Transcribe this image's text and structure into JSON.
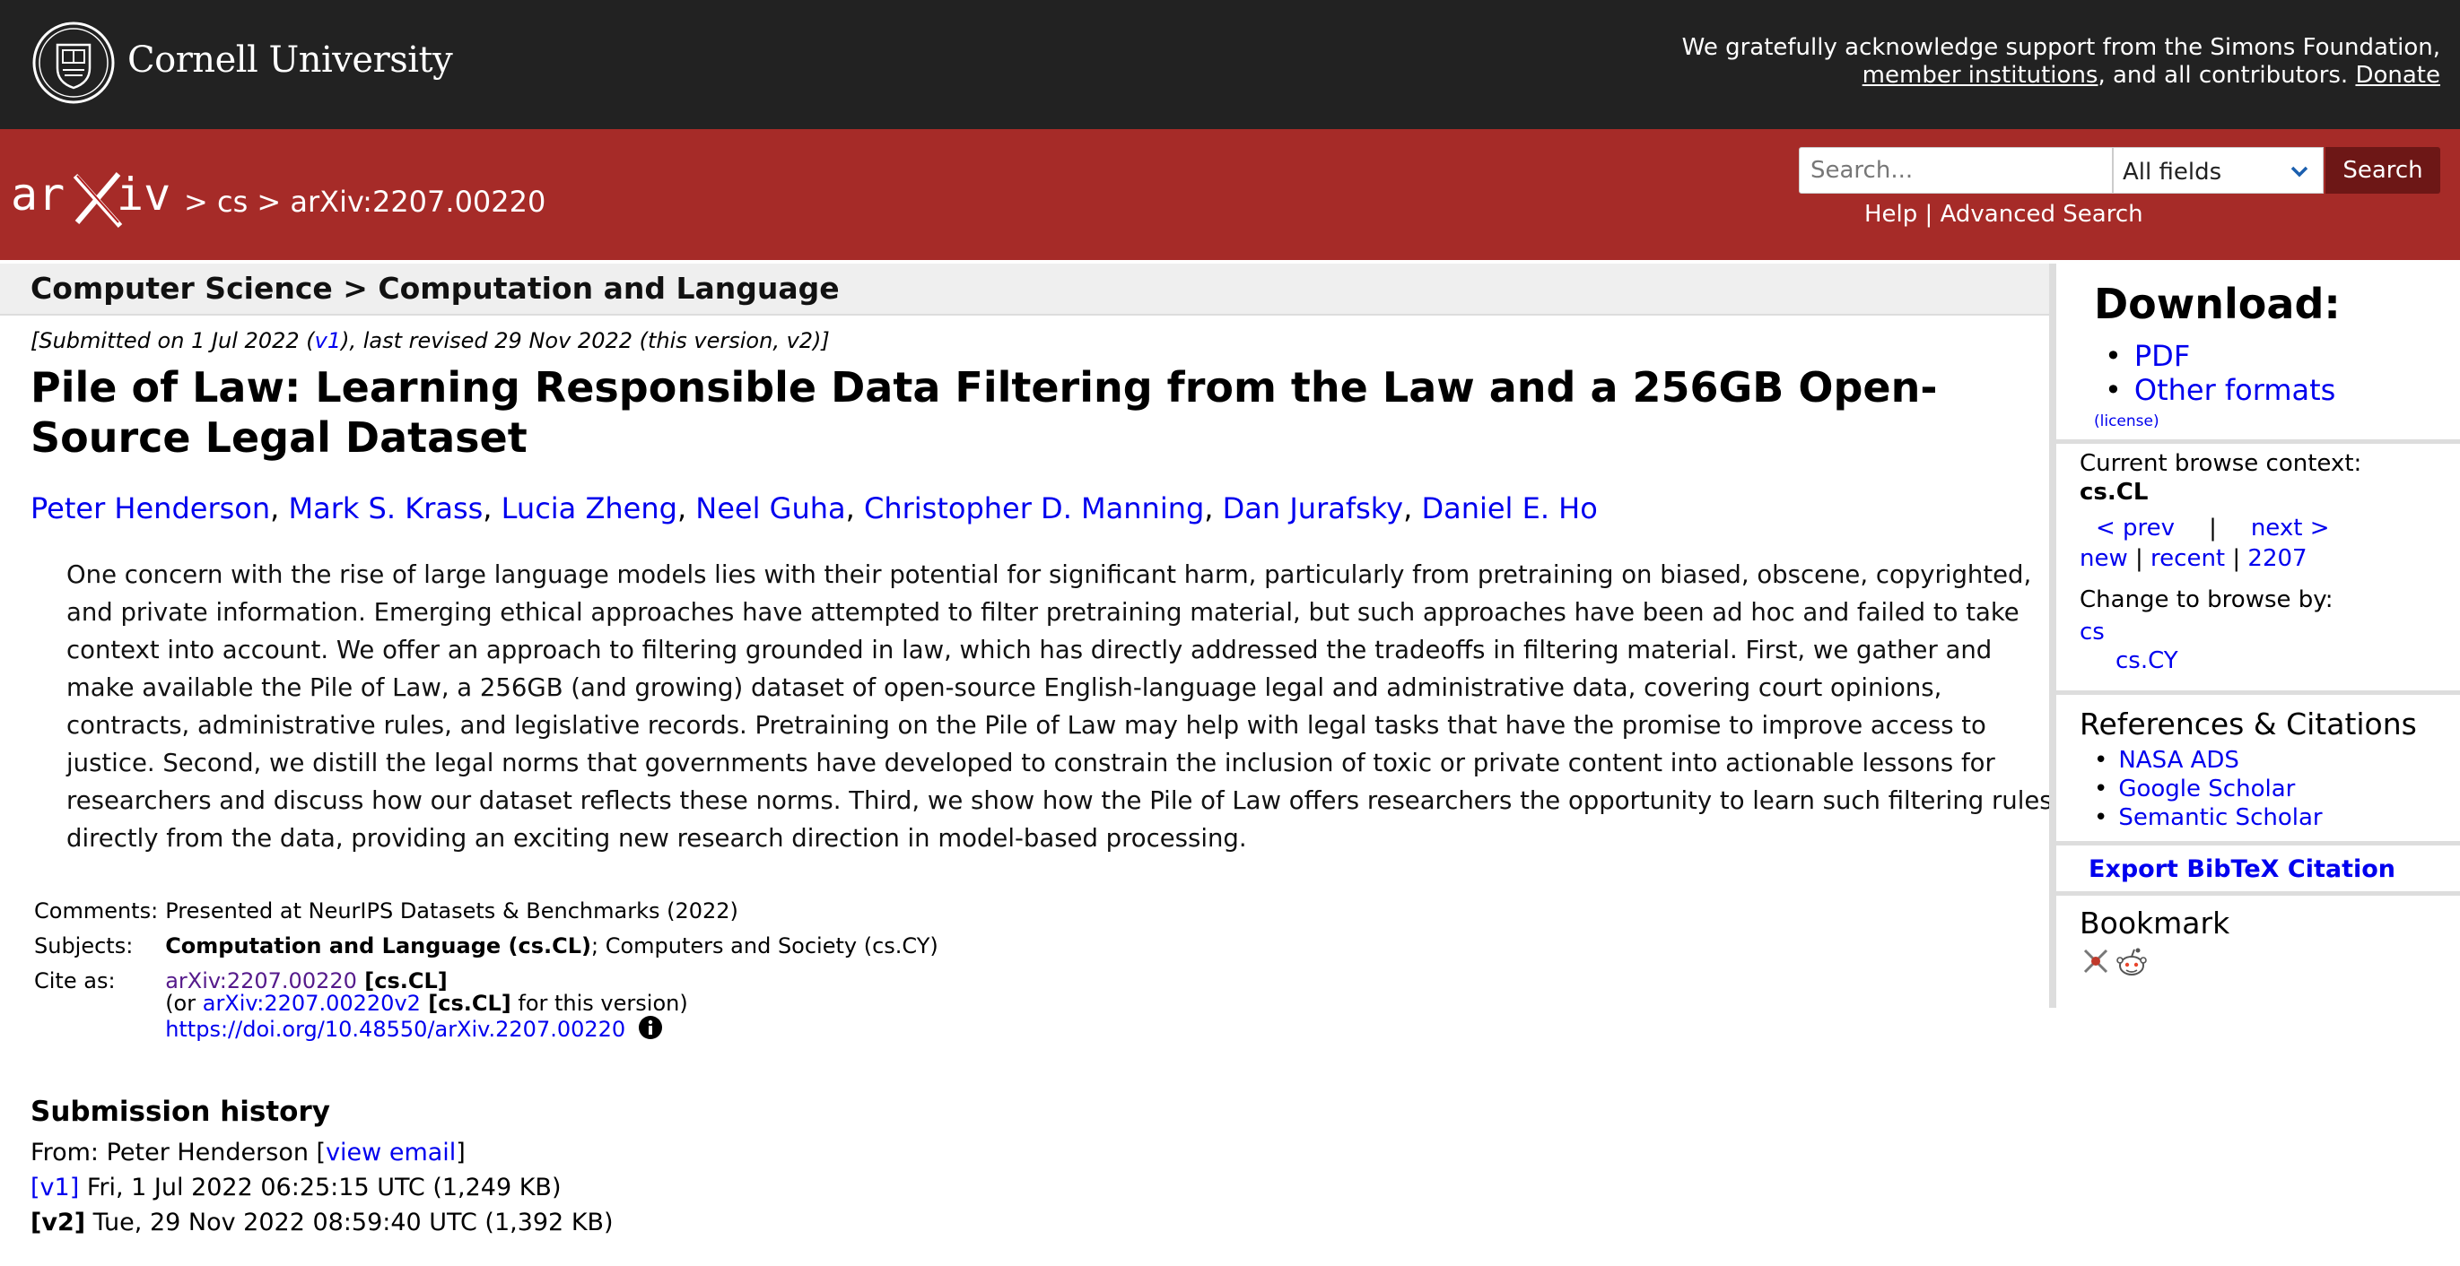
{
  "top_bar": {
    "university_name": "Cornell University",
    "ack_line1": "We gratefully acknowledge support from the Simons Foundation,",
    "ack_member_link": "member institutions",
    "ack_middle": ", and all contributors.",
    "ack_donate_link": "Donate"
  },
  "header": {
    "breadcrumb": "> cs > arXiv:2207.00220",
    "search_placeholder": "Search...",
    "field_select": "All fields",
    "search_button": "Search",
    "help_link": "Help",
    "help_sep": " | ",
    "advanced_link": "Advanced Search"
  },
  "subject_heading": "Computer Science > Computation and Language",
  "dateline": {
    "prefix": "[Submitted on 1 Jul 2022 (",
    "v1_link": "v1",
    "suffix": "), last revised 29 Nov 2022 (this version, v2)]"
  },
  "title": "Pile of Law: Learning Responsible Data Filtering from the Law and a 256GB Open-Source Legal Dataset",
  "authors": [
    "Peter Henderson",
    "Mark S. Krass",
    "Lucia Zheng",
    "Neel Guha",
    "Christopher D. Manning",
    "Dan Jurafsky",
    "Daniel E. Ho"
  ],
  "author_sep": ", ",
  "abstract_lines": [
    "One concern with the rise of large language models lies with their potential for significant harm, particularly from pretraining on biased, obscene, copyrighted,",
    "and private information. Emerging ethical approaches have attempted to filter pretraining material, but such approaches have been ad hoc and failed to take",
    "context into account. We offer an approach to filtering grounded in law, which has directly addressed the tradeoffs in filtering material. First, we gather and",
    "make available the Pile of Law, a 256GB (and growing) dataset of open-source English-language legal and administrative data, covering court opinions,",
    "contracts, administrative rules, and legislative records. Pretraining on the Pile of Law may help with legal tasks that have the promise to improve access to",
    "justice. Second, we distill the legal norms that governments have developed to constrain the inclusion of toxic or private content into actionable lessons for",
    "researchers and discuss how our dataset reflects these norms. Third, we show how the Pile of Law offers researchers the opportunity to learn such filtering rules",
    "directly from the data, providing an exciting new research direction in model-based processing."
  ],
  "metadata": {
    "comments_label": "Comments:",
    "comments": "Presented at NeurIPS Datasets & Benchmarks (2022)",
    "subjects_label": "Subjects:",
    "subject_primary": "Computation and Language (cs.CL)",
    "subject_rest": "; Computers and Society (cs.CY)",
    "cite_label": "Cite as:",
    "cite_id": "arXiv:2207.00220",
    "cite_cat": " [cs.CL]",
    "cite_or_prefix": "(or ",
    "cite_v2_link": "arXiv:2207.00220v2",
    "cite_v2_cat": " [cs.CL]",
    "cite_v2_suffix": " for this version)",
    "doi_link": "https://doi.org/10.48550/arXiv.2207.00220"
  },
  "history": {
    "title": "Submission history",
    "from_prefix": "From: Peter Henderson [",
    "view_email": "view email",
    "from_suffix": "]",
    "v1_label": "[v1]",
    "v1_text": " Fri, 1 Jul 2022 06:25:15 UTC (1,249 KB)",
    "v2_label": "[v2]",
    "v2_text": " Tue, 29 Nov 2022 08:59:40 UTC (1,392 KB)"
  },
  "sidebar": {
    "download_title": "Download:",
    "download_items": [
      "PDF",
      "Other formats"
    ],
    "license": "(license)",
    "context_label": "Current browse context:",
    "context_value": "cs.CL",
    "prev": "< prev",
    "prevnext_sep": "|",
    "next": "next >",
    "new": "new",
    "recent": "recent",
    "month": "2207",
    "link_sep": " | ",
    "change_label": "Change to browse by:",
    "browse_cs": "cs",
    "browse_cscy": "cs.CY",
    "refs_title": "References & Citations",
    "refs": [
      "NASA ADS",
      "Google Scholar",
      "Semantic Scholar"
    ],
    "bibtex": "Export BibTeX Citation",
    "bookmark_title": "Bookmark"
  },
  "colors": {
    "top_bar": "#222222",
    "header_red": "#a62b28",
    "search_button": "#6d1716",
    "link": "#0000ee",
    "visited_link": "#551a8b"
  }
}
